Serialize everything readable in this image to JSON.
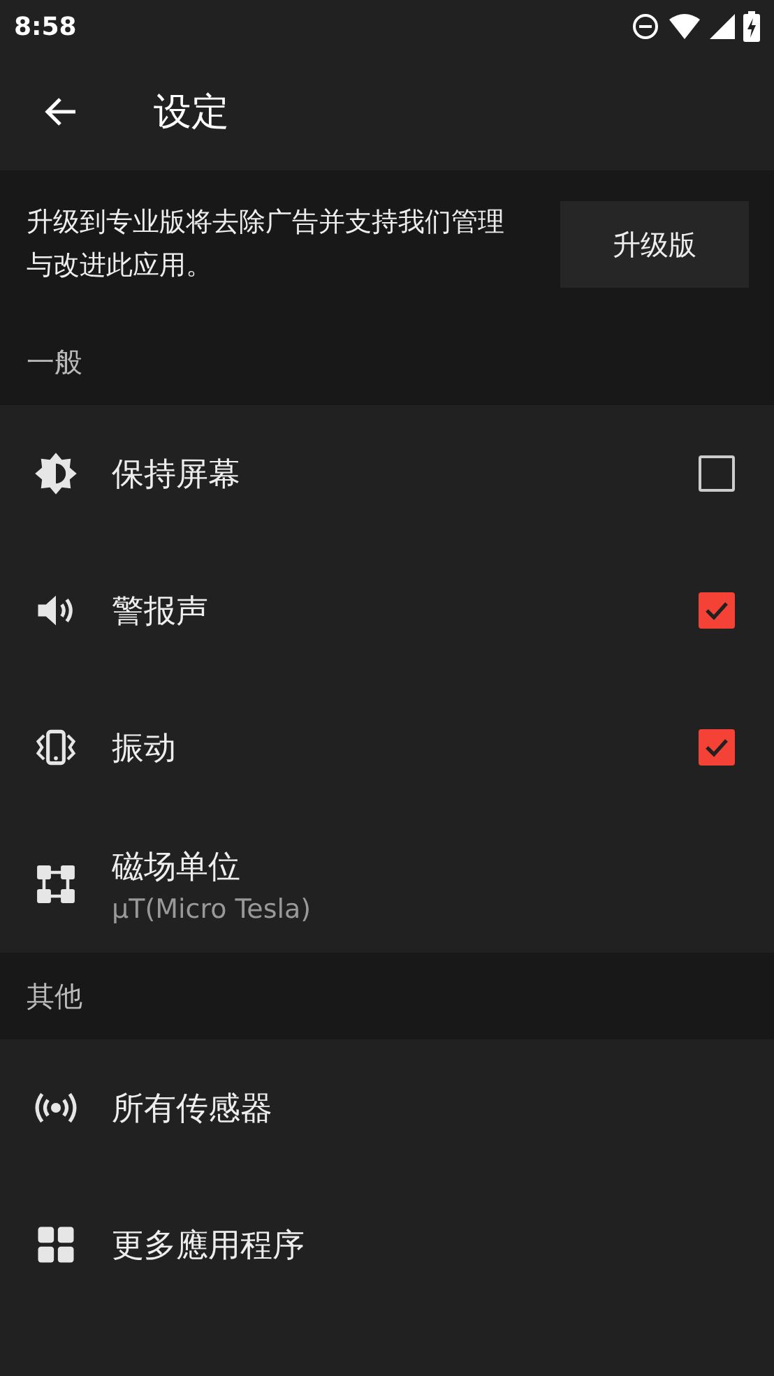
{
  "status_bar": {
    "time": "8:58"
  },
  "toolbar": {
    "title": "设定"
  },
  "banner": {
    "text": "升级到专业版将去除广告并支持我们管理与改进此应用。",
    "button": "升级版"
  },
  "sections": [
    {
      "header": "一般",
      "items": [
        {
          "kind": "checkbox",
          "label": "保持屏幕",
          "checked": false
        },
        {
          "kind": "checkbox",
          "label": "警报声",
          "checked": true
        },
        {
          "kind": "checkbox",
          "label": "振动",
          "checked": true
        },
        {
          "kind": "subtitle",
          "label": "磁场单位",
          "subtitle": "μT(Micro Tesla)"
        }
      ]
    },
    {
      "header": "其他",
      "items": [
        {
          "kind": "plain",
          "label": "所有传感器"
        },
        {
          "kind": "plain",
          "label": "更多應用程序"
        }
      ]
    }
  ]
}
